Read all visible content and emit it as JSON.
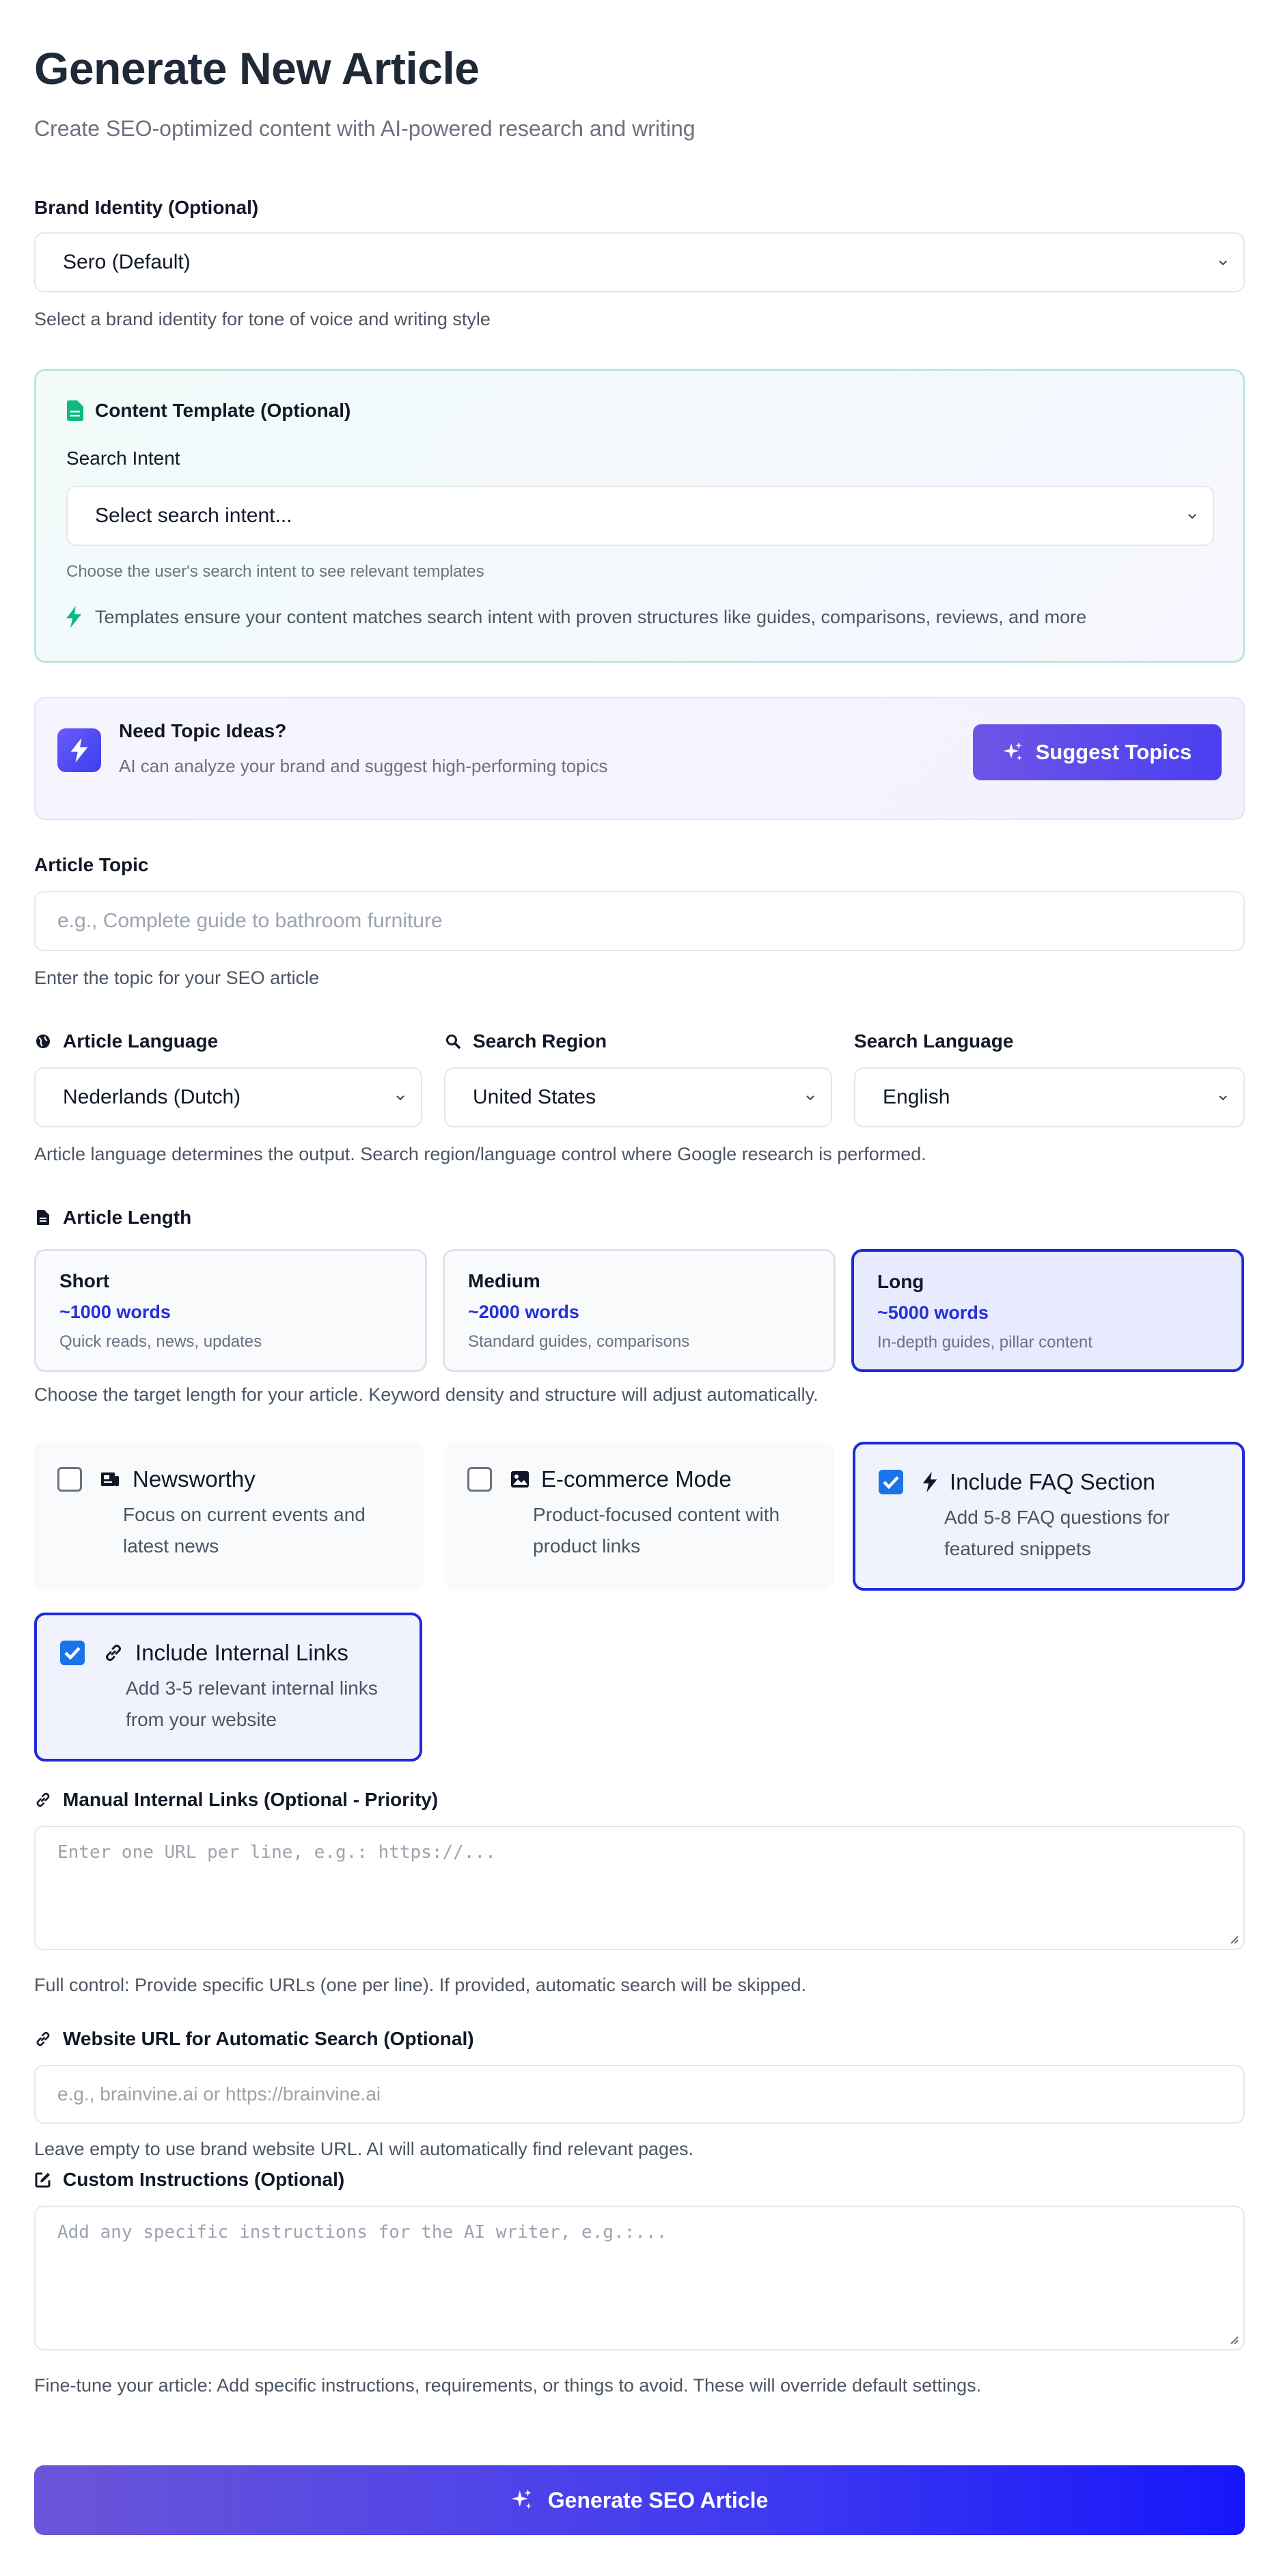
{
  "page": {
    "title": "Generate New Article",
    "subtitle": "Create SEO-optimized content with AI-powered research and writing"
  },
  "brand": {
    "label": "Brand Identity (Optional)",
    "value": "Sero (Default)",
    "help": "Select a brand identity for tone of voice and writing style"
  },
  "template": {
    "heading": "Content Template (Optional)",
    "intent_label": "Search Intent",
    "intent_value": "Select search intent...",
    "intent_help": "Choose the user's search intent to see relevant templates",
    "tip": "Templates ensure your content matches search intent with proven structures like guides, comparisons, reviews, and more"
  },
  "topic_ideas": {
    "title": "Need Topic Ideas?",
    "desc": "AI can analyze your brand and suggest high-performing topics",
    "button": "Suggest Topics"
  },
  "article_topic": {
    "label": "Article Topic",
    "placeholder": "e.g., Complete guide to bathroom furniture",
    "help": "Enter the topic for your SEO article"
  },
  "language": {
    "article_language_label": "Article Language",
    "article_language_value": "Nederlands (Dutch)",
    "search_region_label": "Search Region",
    "search_region_value": "United States",
    "search_language_label": "Search Language",
    "search_language_value": "English",
    "help": "Article language determines the output. Search region/language control where Google research is performed."
  },
  "length": {
    "label": "Article Length",
    "options": [
      {
        "title": "Short",
        "words": "~1000 words",
        "desc": "Quick reads, news, updates"
      },
      {
        "title": "Medium",
        "words": "~2000 words",
        "desc": "Standard guides, comparisons"
      },
      {
        "title": "Long",
        "words": "~5000 words",
        "desc": "In-depth guides, pillar content"
      }
    ],
    "selected": "Long",
    "help": "Choose the target length for your article. Keyword density and structure will adjust automatically."
  },
  "options": [
    {
      "title": "Newsworthy",
      "desc": "Focus on current events and latest news",
      "checked": false
    },
    {
      "title": "E-commerce Mode",
      "desc": "Product-focused content with product links",
      "checked": false
    },
    {
      "title": "Include FAQ Section",
      "desc": "Add 5-8 FAQ questions for featured snippets",
      "checked": true
    },
    {
      "title": "Include Internal Links",
      "desc": "Add 3-5 relevant internal links from your website",
      "checked": true
    }
  ],
  "manual_links": {
    "label": "Manual Internal Links (Optional - Priority)",
    "placeholder": "Enter one URL per line, e.g.: https://...",
    "help": "Full control: Provide specific URLs (one per line). If provided, automatic search will be skipped."
  },
  "website_url": {
    "label": "Website URL for Automatic Search (Optional)",
    "placeholder": "e.g., brainvine.ai or https://brainvine.ai",
    "help": "Leave empty to use brand website URL. AI will automatically find relevant pages."
  },
  "custom": {
    "label": "Custom Instructions (Optional)",
    "placeholder": "Add any specific instructions for the AI writer, e.g.:...",
    "help": "Fine-tune your article: Add specific instructions, requirements, or things to avoid. These will override default settings."
  },
  "generate_button": "Generate SEO Article",
  "colors": {
    "accent": "#1f2bd9",
    "button_gradient_start": "#6b55d8",
    "button_gradient_end": "#1616fb",
    "template_icon": "#10b981",
    "checkbox": "#1a73e8"
  }
}
